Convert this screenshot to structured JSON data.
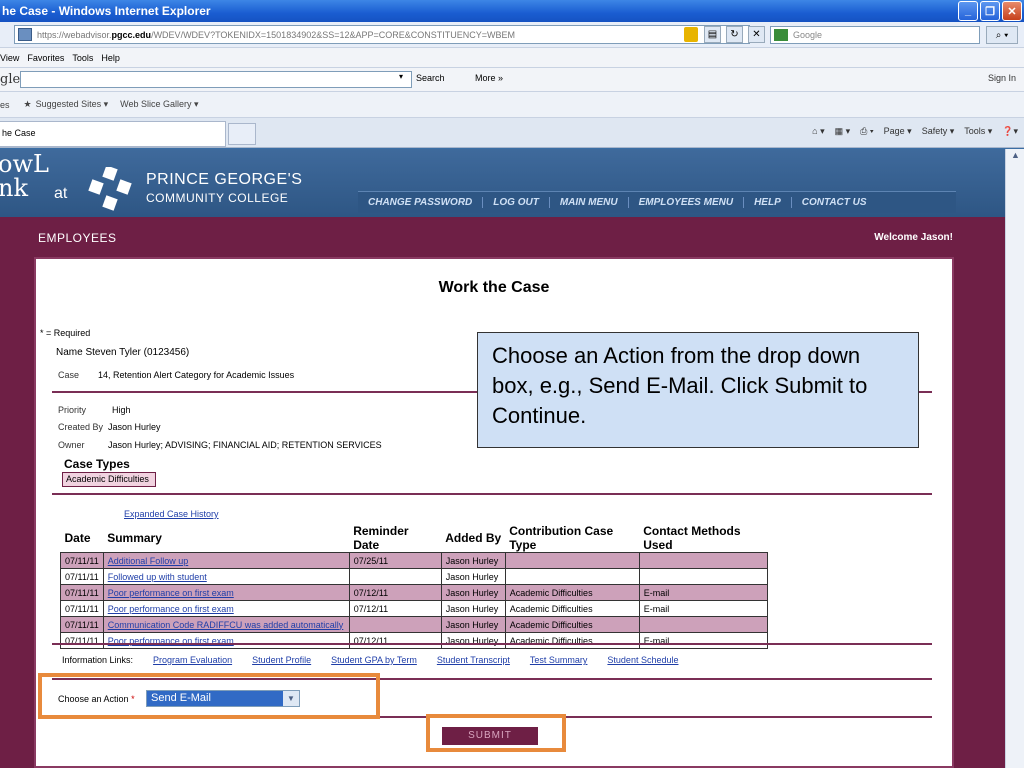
{
  "window": {
    "title": "he Case - Windows Internet Explorer"
  },
  "address": {
    "prefix": "https://webadvisor.",
    "domain": "pgcc.edu",
    "rest": "/WDEV/WDEV?TOKENIDX=1501834902&SS=12&APP=CORE&CONSTITUENCY=WBEM",
    "search_placeholder": "Google"
  },
  "menu": [
    "View",
    "Favorites",
    "Tools",
    "Help"
  ],
  "googlebar": {
    "logo": "gle",
    "search": "Search",
    "more": "More »",
    "signin": "Sign In"
  },
  "favorites": {
    "items": [
      "es",
      "Suggested Sites ▾",
      "Web Slice Gallery ▾"
    ]
  },
  "tab": {
    "label": "he Case"
  },
  "commandbar": [
    "Page ▾",
    "Safety ▾",
    "Tools ▾"
  ],
  "site": {
    "brand_l1": "owL",
    "brand_l2": "nk",
    "brand_at": "at",
    "college_l1": "PRINCE GEORGE'S",
    "college_l2": "COMMUNITY COLLEGE",
    "nav": [
      "CHANGE PASSWORD",
      "LOG OUT",
      "MAIN MENU",
      "EMPLOYEES MENU",
      "HELP",
      "CONTACT US"
    ],
    "section": "EMPLOYEES",
    "welcome": "Welcome Jason!"
  },
  "page": {
    "title": "Work the Case",
    "required_note": "* = Required",
    "name_line": "Name Steven Tyler (0123456)",
    "case_label": "Case",
    "case_value": "14, Retention Alert Category for Academic Issues",
    "priority_label": "Priority",
    "priority_value": "High",
    "created_label": "Created By",
    "created_value": "Jason Hurley",
    "owner_label": "Owner",
    "owner_value": "Jason Hurley; ADVISING; FINANCIAL AID; RETENTION SERVICES",
    "case_types_title": "Case Types",
    "case_type": "Academic Difficulties",
    "expanded_history": "Expanded Case History"
  },
  "history": {
    "headers": [
      "Date",
      "Summary",
      "Reminder Date",
      "Added By",
      "Contribution Case Type",
      "Contact Methods Used"
    ],
    "rows": [
      {
        "date": "07/11/11",
        "summary": "Additional Follow up",
        "reminder": "07/25/11",
        "added": "Jason Hurley",
        "type": "",
        "contact": ""
      },
      {
        "date": "07/11/11",
        "summary": "Followed up with student",
        "reminder": "",
        "added": "Jason Hurley",
        "type": "",
        "contact": ""
      },
      {
        "date": "07/11/11",
        "summary": "Poor performance on first exam",
        "reminder": "07/12/11",
        "added": "Jason Hurley",
        "type": "Academic Difficulties",
        "contact": "E-mail"
      },
      {
        "date": "07/11/11",
        "summary": "Poor performance on first exam",
        "reminder": "07/12/11",
        "added": "Jason Hurley",
        "type": "Academic Difficulties",
        "contact": "E-mail"
      },
      {
        "date": "07/11/11",
        "summary": "Communication Code RADIFFCU was added automatically",
        "reminder": "",
        "added": "Jason Hurley",
        "type": "Academic Difficulties",
        "contact": ""
      },
      {
        "date": "07/11/11",
        "summary": "Poor performance on first exam",
        "reminder": "07/12/11",
        "added": "Jason Hurley",
        "type": "Academic Difficulties",
        "contact": "E-mail"
      }
    ]
  },
  "info": {
    "label": "Information Links:",
    "links": [
      "Program Evaluation",
      "Student Profile",
      "Student GPA by Term",
      "Student Transcript",
      "Test Summary",
      "Student Schedule"
    ]
  },
  "action": {
    "label": "Choose an Action",
    "required_mark": "*",
    "selected": "Send E-Mail",
    "submit": "SUBMIT"
  },
  "callout": {
    "text": "Choose an Action from the drop down box, e.g., Send E-Mail. Click Submit to Continue."
  },
  "colors": {
    "maroon": "#6e1f45",
    "header_blue": "#2e5684",
    "highlight_orange": "#e88a3c",
    "callout_blue": "#cfe0f5"
  }
}
